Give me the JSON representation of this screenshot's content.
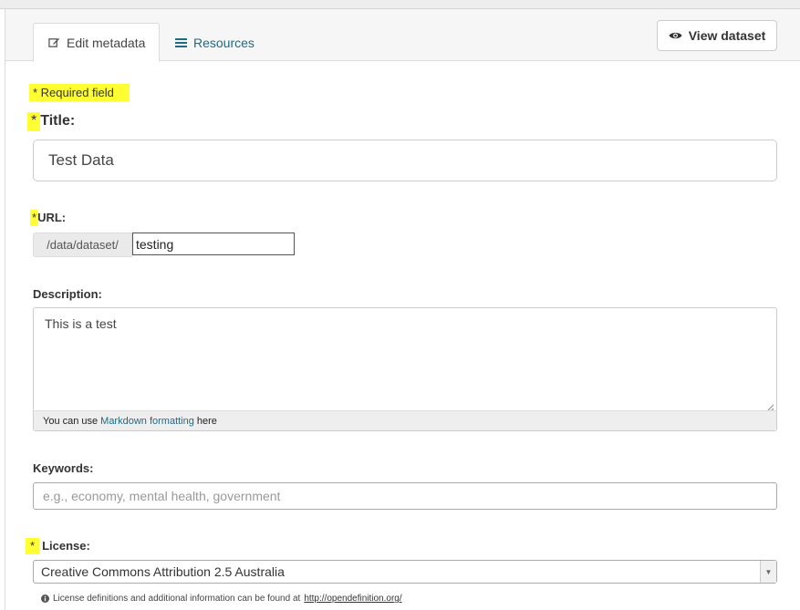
{
  "tabs": {
    "edit_label": "Edit metadata",
    "resources_label": "Resources",
    "view_button_label": "View dataset"
  },
  "form": {
    "required_note": "* Required field",
    "required_star": "*",
    "title": {
      "label": "Title:",
      "value": "Test Data"
    },
    "url": {
      "label": "URL:",
      "prefix": "/data/dataset/",
      "value": "testing"
    },
    "description": {
      "label": "Description:",
      "value": "This is a test",
      "markdown_before": "You can use",
      "markdown_link": "Markdown formatting",
      "markdown_after": "here"
    },
    "keywords": {
      "label": "Keywords:",
      "placeholder": "e.g., economy, mental health, government"
    },
    "license": {
      "label": "License:",
      "selected": "Creative Commons Attribution 2.5 Australia",
      "help_text": "License definitions and additional information can be found at",
      "help_link": "http://opendefinition.org/"
    }
  },
  "icons": {
    "edit": "pencil-square-icon",
    "resources": "list-icon",
    "view": "eye-icon",
    "info": "info-circle-icon",
    "dropdown": "caret-down-icon"
  },
  "colors": {
    "highlight": "#ffff33",
    "link": "#206b82"
  }
}
